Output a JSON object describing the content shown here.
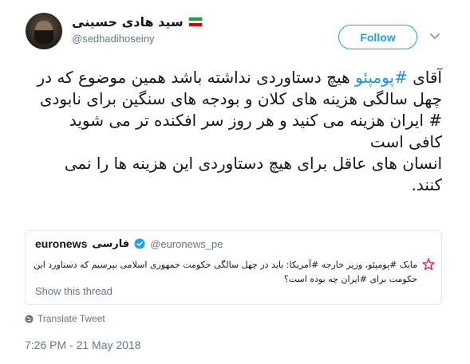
{
  "user": {
    "display_name": "سید هادی حسینی",
    "handle": "@sedhadihoseiny",
    "flag_colors": [
      "#239f40",
      "#ffffff",
      "#da0000"
    ]
  },
  "follow_label": "Follow",
  "tweet": {
    "lines": [
      {
        "prefix": "آقای ",
        "hashtag": "#پومپئو",
        "suffix": " هیچ دستاوردی نداشته باشد همین موضوع که در"
      },
      {
        "text": "چهل سالگی هزینه های کلان و بودجه های سنگین برای نابودی"
      },
      {
        "text": "# ایران  هزینه می کنید و هر روز سر افکنده تر می شوید"
      },
      {
        "text": "کافی است"
      },
      {
        "text": "انسان های عاقل برای هیچ دستاوردی این هزینه ها را نمی"
      },
      {
        "text": "کنند."
      }
    ]
  },
  "quoted": {
    "brand": "euronews",
    "brand_fa": "فارسی",
    "handle": "@euronews_pe",
    "lines": [
      "مایک #پومپئو، وزیر خارجه #آمریکا: باید در چهل سالگی حکومت جمهوری اسلامی بپرسیم که دستاورد این",
      "حکومت برای #ایران چه بوده است؟"
    ],
    "show_thread": "Show this thread"
  },
  "translate_label": "Translate Tweet",
  "timestamp": "7:26 PM - 21 May 2018",
  "colors": {
    "accent": "#1da1f2",
    "hashtag": "#1b95e0",
    "muted": "#657786",
    "star": "#e0245e"
  },
  "icons": {
    "chevron": "chevron-down-icon",
    "verified": "verified-badge-icon",
    "globe": "globe-icon",
    "star": "star-icon"
  }
}
